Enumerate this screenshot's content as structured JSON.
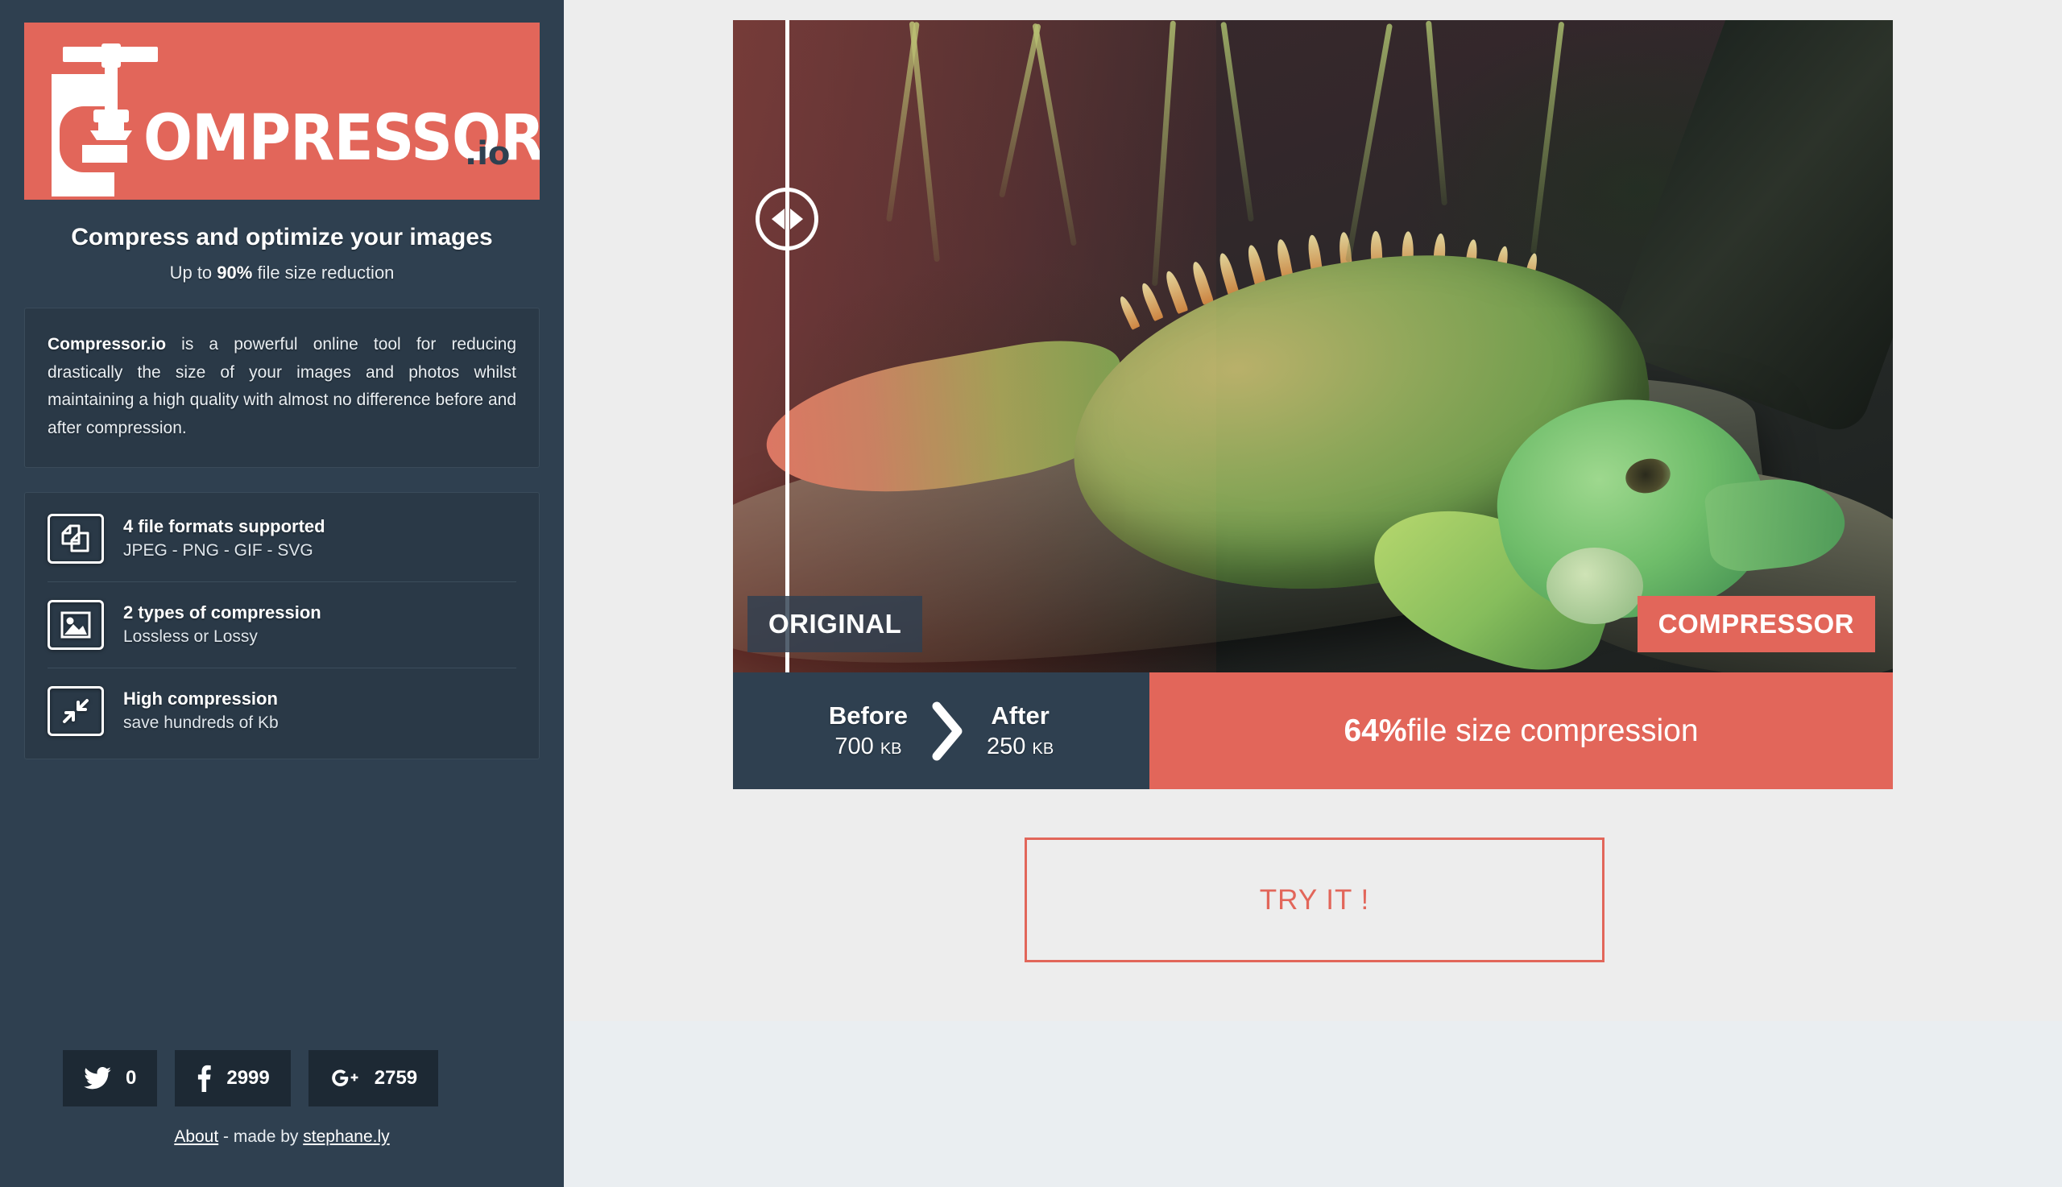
{
  "sidebar": {
    "logo": {
      "word": "OMPRESSOR",
      "suffix": ".io",
      "clamp_icon": "clamp-icon"
    },
    "tagline": "Compress and optimize your images",
    "subtagline_prefix": "Up to ",
    "subtagline_strong": "90%",
    "subtagline_suffix": " file size reduction",
    "about": {
      "brand": "Compressor.io",
      "text": " is a powerful online tool for reducing drastically the size of your images and photos whilst maintaining a high quality with almost no difference before and after compression."
    },
    "features": [
      {
        "icon": "documents-icon",
        "title": "4 file formats supported",
        "sub": "JPEG - PNG - GIF - SVG"
      },
      {
        "icon": "image-icon",
        "title": "2 types of compression",
        "sub": "Lossless or Lossy"
      },
      {
        "icon": "compress-arrows-icon",
        "title": "High compression",
        "sub": "save hundreds of Kb"
      }
    ],
    "social": [
      {
        "icon": "twitter-icon",
        "count": "0"
      },
      {
        "icon": "facebook-icon",
        "count": "2999"
      },
      {
        "icon": "googleplus-icon",
        "count": "2759"
      }
    ],
    "credit": {
      "about_link": "About",
      "separator": " - made by ",
      "author_link": "stephane.ly"
    }
  },
  "main": {
    "compare": {
      "label_original": "ORIGINAL",
      "label_compressed": "COMPRESSOR",
      "handle_icon": "slider-handle-icon",
      "photo_alt": "green iguana on a log"
    },
    "stats": {
      "before_label": "Before",
      "before_value": "700",
      "before_unit": "KB",
      "arrow_icon": "chevron-right-icon",
      "after_label": "After",
      "after_value": "250",
      "after_unit": "KB",
      "compression_percent": "64%",
      "compression_text": " file size compression"
    },
    "try_button": "TRY IT !"
  },
  "colors": {
    "accent": "#e2665a",
    "sidebar_bg": "#2f4050",
    "panel_bg": "#2a3947",
    "page_bg": "#ededed",
    "page_bg_lower": "#eaeef1",
    "social_bg": "#1d2934"
  }
}
